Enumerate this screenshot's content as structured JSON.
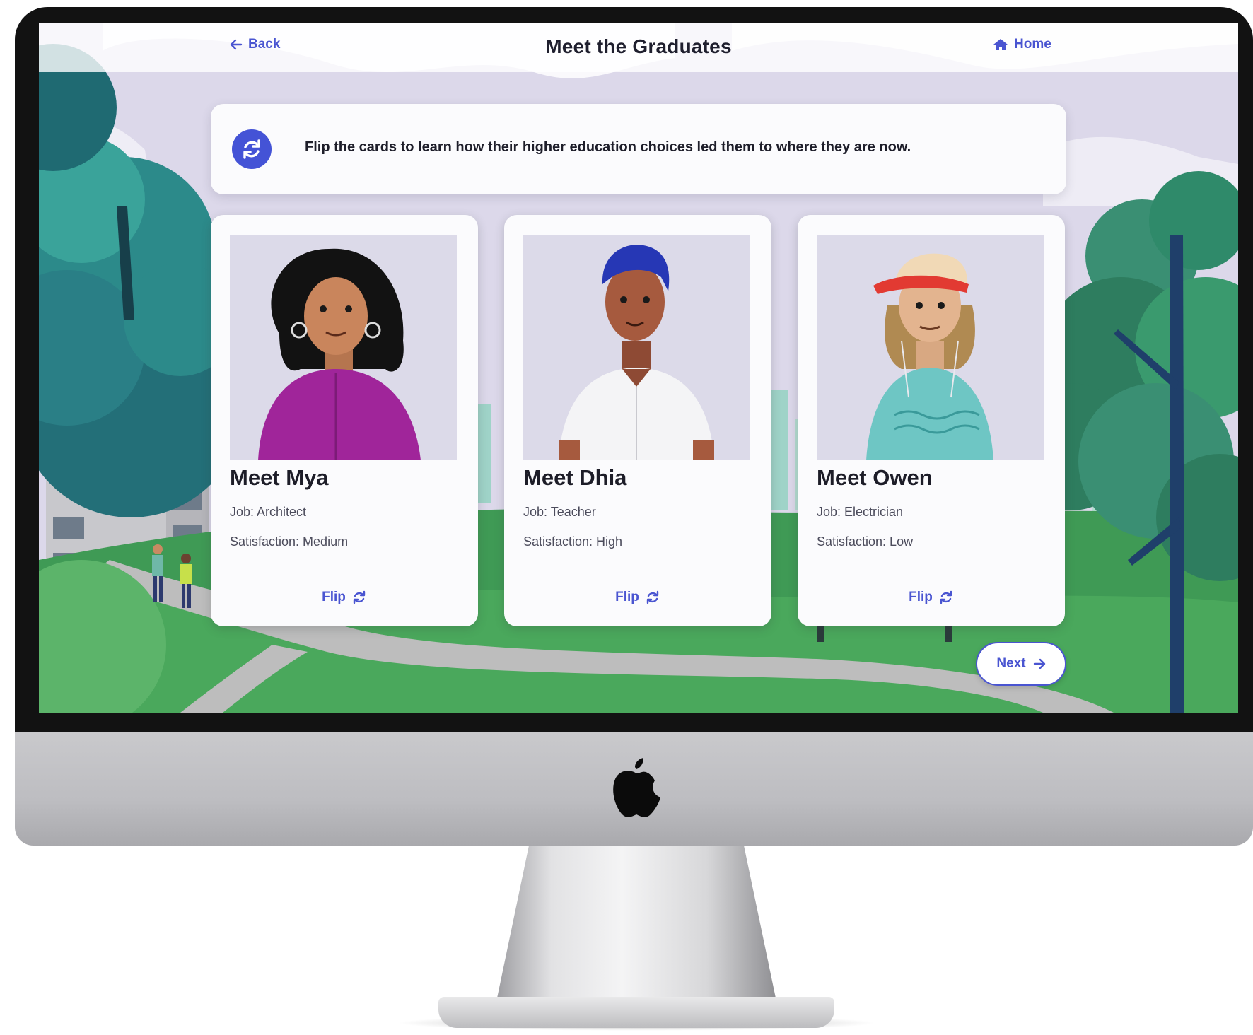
{
  "header": {
    "back_label": "Back",
    "title": "Meet the Graduates",
    "home_label": "Home"
  },
  "instruction": {
    "icon": "refresh-icon",
    "text": "Flip the cards to learn how their higher education choices led them to where they are now."
  },
  "cards": [
    {
      "name": "Meet Mya",
      "job": "Job: Architect",
      "satisfaction": "Satisfaction: Medium",
      "flip_label": "Flip"
    },
    {
      "name": "Meet Dhia",
      "job": "Job: Teacher",
      "satisfaction": "Satisfaction: High",
      "flip_label": "Flip"
    },
    {
      "name": "Meet Owen",
      "job": "Job: Electrician",
      "satisfaction": "Satisfaction: Low",
      "flip_label": "Flip"
    }
  ],
  "footer": {
    "next_label": "Next"
  },
  "colors": {
    "accent": "#4a55d1",
    "card_bg": "#fbfbfd",
    "grass": "#3f9a55",
    "path": "#bdbdbd",
    "tree_dark": "#1f6a72",
    "tree_light": "#3a8f73"
  }
}
